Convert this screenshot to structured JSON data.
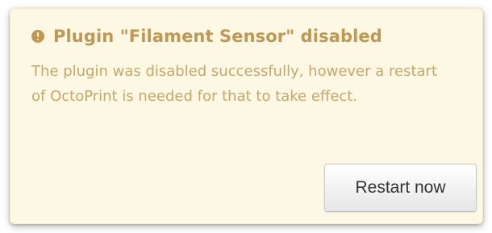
{
  "notification": {
    "icon": "exclamation-circle-icon",
    "title": "Plugin \"Filament Sensor\" disabled",
    "message": "The plugin was disabled successfully, however a restart of OctoPrint is needed for that to take effect.",
    "action_label": "Restart now",
    "colors": {
      "background": "#fcf8e3",
      "text": "#c09853"
    }
  }
}
